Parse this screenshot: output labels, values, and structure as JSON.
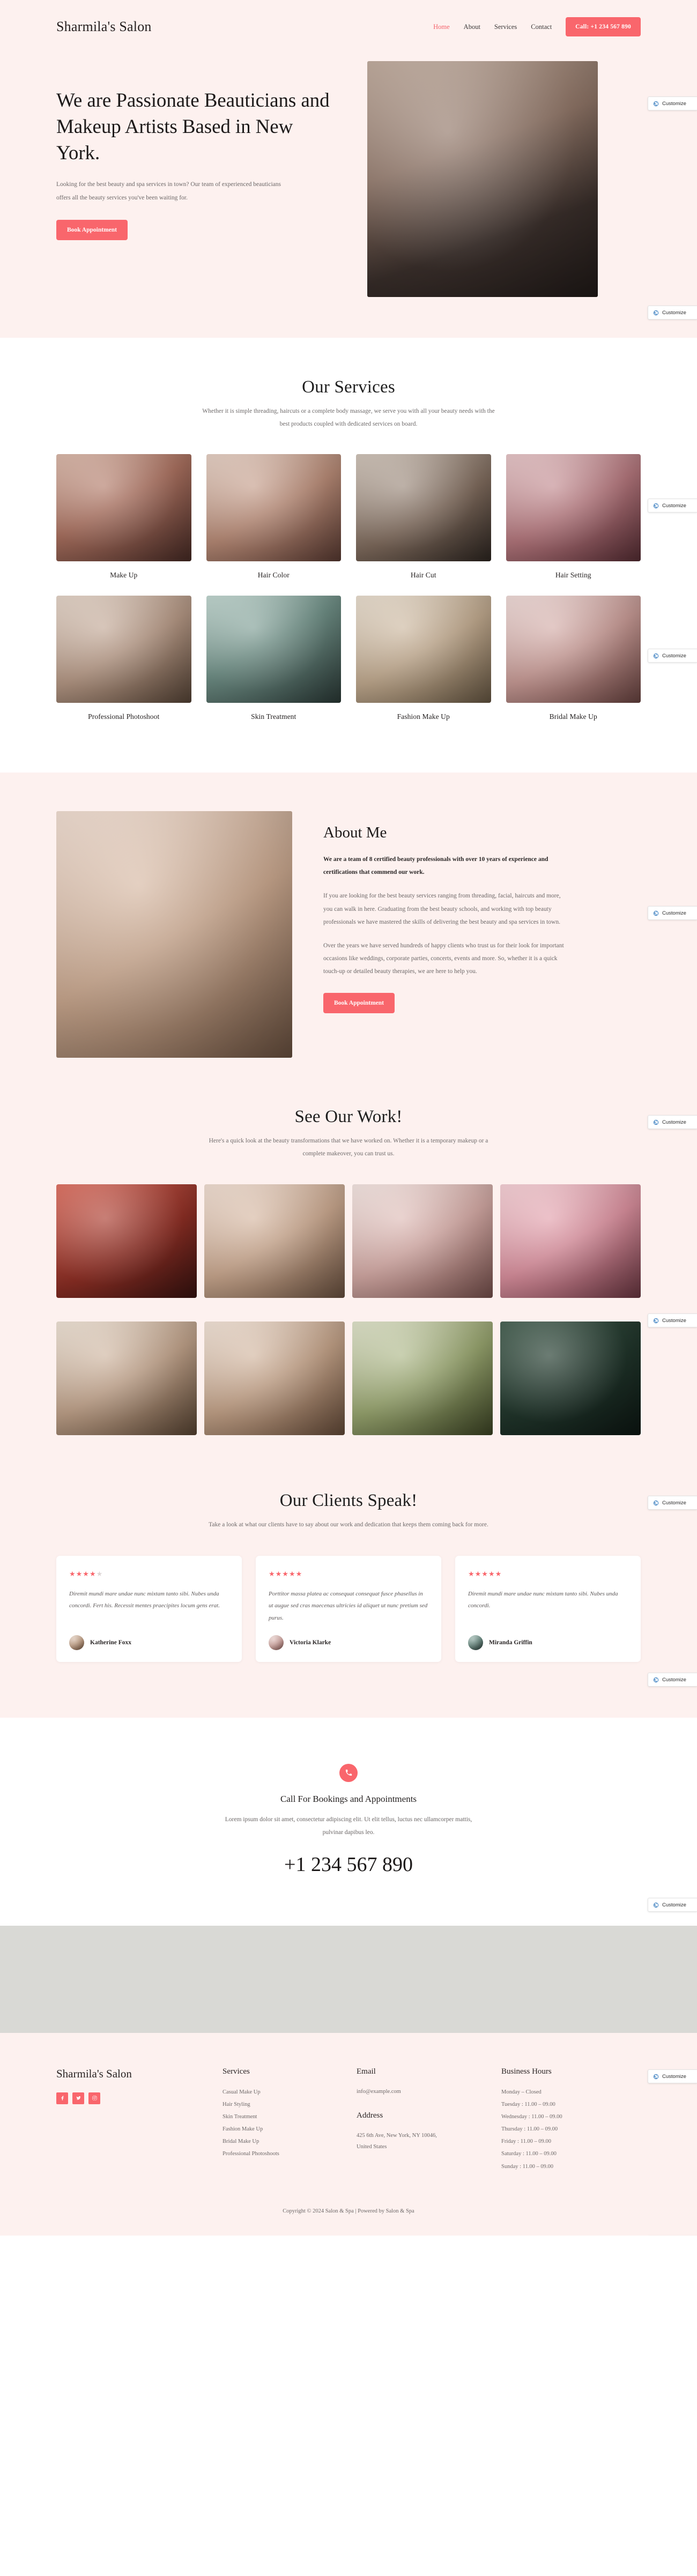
{
  "brand": "Sharmila's Salon",
  "accent": "#f9666c",
  "bg_pink": "#fdf1ef",
  "nav": {
    "items": [
      {
        "label": "Home",
        "active": true
      },
      {
        "label": "About",
        "active": false
      },
      {
        "label": "Services",
        "active": false
      },
      {
        "label": "Contact",
        "active": false
      }
    ],
    "call_button": "Call: +1 234 567 890"
  },
  "hero": {
    "title": "We are Passionate Beauticians and Makeup Artists Based in New York.",
    "description": "Looking for the best beauty and spa services in town? Our team of experienced beauticians offers all the beauty services you've been waiting for.",
    "cta": "Book Appointment",
    "image_alt": "salon-makeup-artist-photo"
  },
  "services": {
    "title": "Our Services",
    "subtitle": "Whether it is simple threading, haircuts or a complete body massage, we serve you with all your beauty needs with the best products coupled with dedicated services on board.",
    "items": [
      {
        "label": "Make Up"
      },
      {
        "label": "Hair Color"
      },
      {
        "label": "Hair Cut"
      },
      {
        "label": "Hair Setting"
      },
      {
        "label": "Professional Photoshoot"
      },
      {
        "label": "Skin Treatment"
      },
      {
        "label": "Fashion Make Up"
      },
      {
        "label": "Bridal Make Up"
      }
    ]
  },
  "about": {
    "title": "About Me",
    "lead": "We are a team of 8 certified beauty professionals with over 10 years of experience and certifications that commend our work.",
    "paragraph1": "If you are looking for the best beauty services ranging from threading, facial, haircuts and more, you can walk in here. Graduating from the best beauty schools, and working with top beauty professionals we have mastered the skills of delivering the best beauty and spa services in town.",
    "paragraph2": "Over the years we have served hundreds of happy clients who trust us for their look for important occasions like weddings, corporate parties, concerts, events and more. So, whether it is a quick touch-up or detailed beauty therapies, we are here to help you.",
    "cta": "Book Appointment"
  },
  "gallery": {
    "title": "See Our Work!",
    "subtitle": "Here's a quick look at the beauty transformations that we have worked on. Whether it is a temporary makeup or a complete makeover, you can trust us."
  },
  "testimonials": {
    "title": "Our Clients Speak!",
    "subtitle": "Take a look at what our clients have to say about our work and dedication that keeps them coming back for more.",
    "items": [
      {
        "rating": 4,
        "rating_display": "★★★★★",
        "text": "Diremit mundi mare undae nunc mixtam tanto sibi. Nubes unda concordi. Fert his. Recessit mentes praecipites locum gens erat.",
        "author": "Katherine Foxx"
      },
      {
        "rating": 5,
        "rating_display": "★★★★★",
        "text": "Porttitor massa platea ac consequat consequat fusce phasellus in ut augue sed cras maecenas ultricies id aliquet ut nunc pretium sed purus.",
        "author": "Victoria Klarke"
      },
      {
        "rating": 5,
        "rating_display": "★★★★★",
        "text": "Diremit mundi mare undae nunc mixtam tanto sibi. Nubes unda concordi.",
        "author": "Miranda Griffin"
      }
    ]
  },
  "cta": {
    "icon": "phone-icon",
    "title": "Call For Bookings and Appointments",
    "description": "Lorem ipsum dolor sit amet, consectetur adipiscing elit. Ut elit tellus, luctus nec ullamcorper mattis, pulvinar dapibus leo.",
    "phone": "+1 234 567 890"
  },
  "footer": {
    "brand": "Sharmila's Salon",
    "social": [
      {
        "name": "facebook-icon"
      },
      {
        "name": "twitter-icon"
      },
      {
        "name": "instagram-icon"
      }
    ],
    "services_heading": "Services",
    "services": [
      "Casual Make Up",
      "Hair Styling",
      "Skin Treatment",
      "Fashion Make Up",
      "Bridal Make Up",
      "Professional Photoshoots"
    ],
    "email_heading": "Email",
    "email": "info@example.com",
    "address_heading": "Address",
    "address": "425 6th Ave, New York, NY 10046, United States",
    "hours_heading": "Business Hours",
    "hours": [
      "Monday – Closed",
      "Tuesday : 11.00 – 09.00",
      "Wednesday : 11.00 – 09.00",
      "Thursday : 11.00 – 09.00",
      "Friday : 11.00 – 09.00",
      "Saturday : 11.00 – 09.00",
      "Sunday : 11.00 – 09.00"
    ],
    "copyright": "Copyright © 2024 Salon & Spa | Powered by Salon & Spa"
  },
  "customize": {
    "label": "Customize",
    "icon": "wordpress-customize-icon",
    "positions": [
      180,
      570,
      930,
      1210,
      1690,
      2080,
      2450,
      2790,
      3120,
      3540,
      3860,
      4170,
      4400
    ]
  }
}
